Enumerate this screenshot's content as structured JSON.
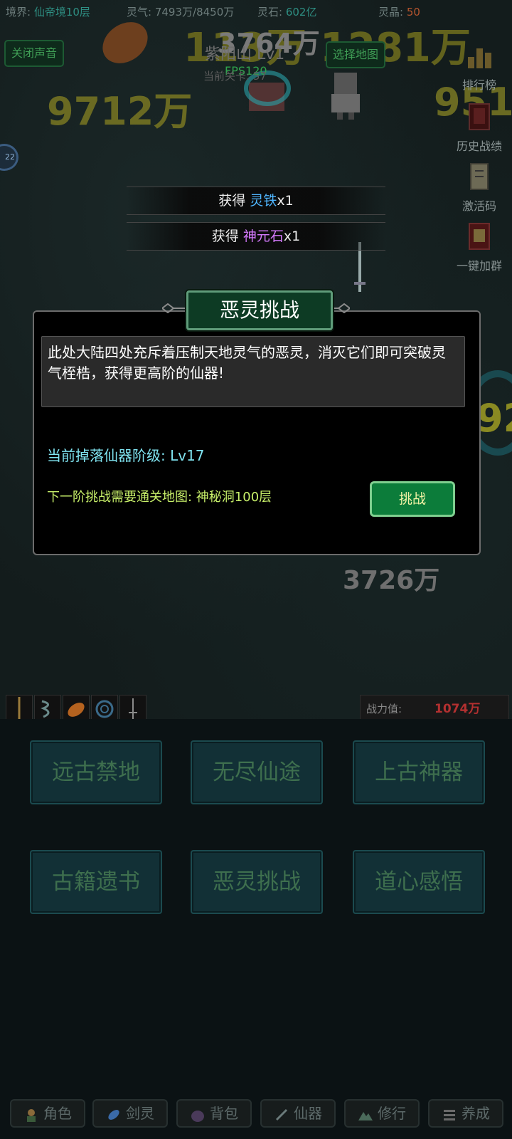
{
  "stats": {
    "realm_label": "境界:",
    "realm_value": "仙帝境10层",
    "qi_label": "灵气:",
    "qi_value": "7493万/8450万",
    "stone_label": "灵石:",
    "stone_value": "602亿",
    "crystal_label": "灵晶:",
    "crystal_value": "50"
  },
  "buttons": {
    "mute": "关闭声音",
    "select_map": "选择地图"
  },
  "scene": {
    "map_name": "紫阳山 Lv1",
    "fps": "FPS120",
    "level_text": "当前关卡: 57",
    "float_numbers": [
      "113万",
      "3764万",
      "1281万",
      "9712万",
      "951",
      "3726万",
      "92"
    ],
    "badge_count": "22"
  },
  "side_menu": [
    {
      "label": "排行榜",
      "icon": "chart-bars-icon"
    },
    {
      "label": "历史战绩",
      "icon": "record-book-icon"
    },
    {
      "label": "激活码",
      "icon": "code-scroll-icon"
    },
    {
      "label": "一键加群",
      "icon": "group-book-icon"
    }
  ],
  "toasts": [
    {
      "prefix": "获得 ",
      "item": "灵铁",
      "suffix": "x1",
      "color": "#4fb6ff"
    },
    {
      "prefix": "获得 ",
      "item": "神元石",
      "suffix": "x1",
      "color": "#d67bff"
    }
  ],
  "dialog": {
    "title": "恶灵挑战",
    "description": "此处大陆四处充斥着压制天地灵气的恶灵，消灭它们即可突破灵气桎梏，获得更高阶的仙器!",
    "drop_level": "当前掉落仙器阶级: Lv17",
    "next_requirement": "下一阶挑战需要通关地图: 神秘洞100层",
    "challenge_button": "挑战"
  },
  "combat": {
    "power_label": "战力值:",
    "power_value": "1074万",
    "skill_icons": [
      "spear-icon",
      "whirlwind-icon",
      "fireball-icon",
      "vortex-icon",
      "sword-icon"
    ]
  },
  "menu_buttons": [
    "远古禁地",
    "无尽仙途",
    "上古神器",
    "古籍遗书",
    "恶灵挑战",
    "道心感悟"
  ],
  "tabs": [
    {
      "label": "角色",
      "icon": "character-icon"
    },
    {
      "label": "剑灵",
      "icon": "sword-spirit-icon"
    },
    {
      "label": "背包",
      "icon": "bag-icon"
    },
    {
      "label": "仙器",
      "icon": "artifact-icon"
    },
    {
      "label": "修行",
      "icon": "mountain-icon"
    },
    {
      "label": "养成",
      "icon": "cultivate-icon"
    }
  ],
  "colors": {
    "accent_green": "#0c7c3a",
    "power_red": "#b33030",
    "realm_teal": "#2e8f83"
  }
}
